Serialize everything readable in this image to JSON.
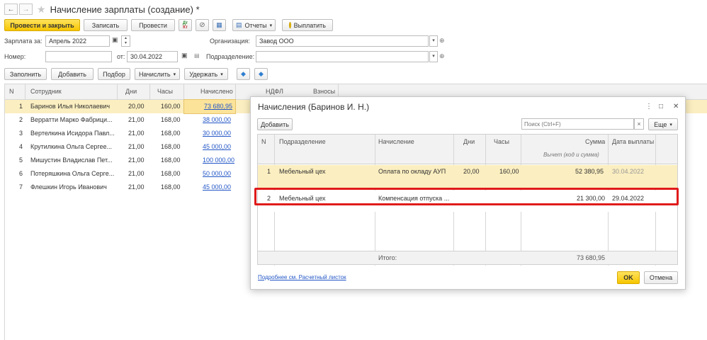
{
  "window": {
    "back": "←",
    "forward": "→",
    "title": "Начисление зарплаты (создание) *"
  },
  "toolbar": {
    "post_close": "Провести и закрыть",
    "save": "Записать",
    "post": "Провести",
    "reports": "Отчеты",
    "pay": "Выплатить"
  },
  "form": {
    "salary_for_label": "Зарплата за:",
    "salary_for_value": "Апрель 2022",
    "org_label": "Организация:",
    "org_value": "Завод ООО",
    "number_label": "Номер:",
    "number_value": "",
    "from_label": "от:",
    "date_value": "30.04.2022",
    "dept_label": "Подразделение:",
    "dept_value": ""
  },
  "actions": {
    "fill": "Заполнить",
    "add": "Добавить",
    "select": "Подбор",
    "accrue": "Начислить",
    "withhold": "Удержать"
  },
  "grid": {
    "headers": {
      "n": "N",
      "employee": "Сотрудник",
      "days": "Дни",
      "hours": "Часы",
      "accrued": "Начислено",
      "ndfl": "НДФЛ",
      "contrib": "Взносы"
    },
    "rows": [
      {
        "n": "1",
        "employee": "Баринов Илья Николаевич",
        "days": "20,00",
        "hours": "160,00",
        "accrued": "73 680,95"
      },
      {
        "n": "2",
        "employee": "Верратти Марко Фабрици...",
        "days": "21,00",
        "hours": "168,00",
        "accrued": "38 000,00"
      },
      {
        "n": "3",
        "employee": "Вертелкина Исидора Павл...",
        "days": "21,00",
        "hours": "168,00",
        "accrued": "30 000,00"
      },
      {
        "n": "4",
        "employee": "Крутилкина Ольга Сергее...",
        "days": "21,00",
        "hours": "168,00",
        "accrued": "45 000,00"
      },
      {
        "n": "5",
        "employee": "Мишустин Владислав Пет...",
        "days": "21,00",
        "hours": "168,00",
        "accrued": "100 000,00"
      },
      {
        "n": "6",
        "employee": "Потеряшкина Ольга Серге...",
        "days": "21,00",
        "hours": "168,00",
        "accrued": "50 000,00"
      },
      {
        "n": "7",
        "employee": "Флешкин Игорь Иванович",
        "days": "21,00",
        "hours": "168,00",
        "accrued": "45 000,00"
      }
    ]
  },
  "dialog": {
    "title": "Начисления (Баринов И. Н.)",
    "more": "⋮",
    "maximize": "□",
    "close": "✕",
    "add": "Добавить",
    "search_placeholder": "Поиск (Ctrl+F)",
    "search_clear": "×",
    "more_btn": "Еще",
    "headers": {
      "n": "N",
      "dept": "Подразделение",
      "accrual": "Начисление",
      "days": "Дни",
      "hours": "Часы",
      "sum": "Сумма",
      "pay_date": "Дата выплаты",
      "deduct": "Вычет (код и сумма)"
    },
    "rows": [
      {
        "n": "1",
        "dept": "Мебельный цех",
        "accrual": "Оплата по окладу АУП",
        "days": "20,00",
        "hours": "160,00",
        "sum": "52 380,95",
        "pay_date": "30.04.2022"
      },
      {
        "n": "2",
        "dept": "Мебельный цех",
        "accrual": "Компенсация отпуска ...",
        "days": "",
        "hours": "",
        "sum": "21 300,00",
        "pay_date": "29.04.2022"
      }
    ],
    "total_label": "Итого:",
    "total_value": "73 680,95",
    "payslip_link": "Подробнее см. Расчетный листок",
    "ok": "OK",
    "cancel": "Отмена"
  },
  "colors": {
    "accent_yellow": "#f6c500",
    "selection": "#fbeec0",
    "highlight_red": "#e01b1b",
    "link_blue": "#2357c6"
  }
}
